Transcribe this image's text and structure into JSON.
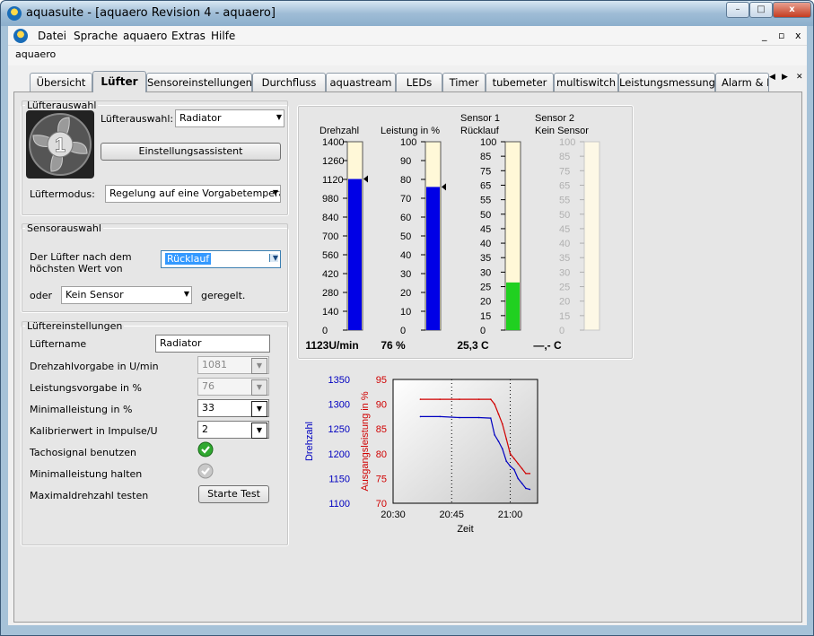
{
  "window": {
    "title": "aquasuite - [aquaero Revision 4 -  aquaero]",
    "buttons": {
      "min": "–",
      "max": "□",
      "close": "x"
    }
  },
  "menu": {
    "items": [
      "Datei",
      "Sprache",
      "aquaero",
      "Extras",
      "Hilfe"
    ],
    "mdi": [
      "_",
      "▫",
      "x"
    ]
  },
  "subtitle": "aquaero",
  "tabs": [
    "Übersicht",
    "Lüfter",
    "Sensoreinstellungen",
    "Durchfluss",
    "aquastream",
    "LEDs",
    "Timer",
    "tubemeter",
    "multiswitch",
    "Leistungsmessung",
    "Alarm & R"
  ],
  "active_tab": "Lüfter",
  "fan_select": {
    "legend": "Lüfterauswahl",
    "fan_number": "1",
    "label": "Lüfterauswahl:",
    "value": "Radiator",
    "assistant": "Einstellungsassistent",
    "mode_label": "Lüftermodus:",
    "mode_value": "Regelung auf eine Vorgabetemperatu"
  },
  "sensor_select": {
    "legend": "Sensorauswahl",
    "text1": "Der Lüfter nach dem",
    "text2": "höchsten Wert von",
    "sensor1": "Rücklauf",
    "or": "oder",
    "sensor2": "Kein Sensor",
    "suffix": "geregelt."
  },
  "fan_settings": {
    "legend": "Lüftereinstellungen",
    "name_label": "Lüftername",
    "name_value": "Radiator",
    "rpm_label": "Drehzahlvorgabe in U/min",
    "rpm_value": "1081",
    "power_label": "Leistungsvorgabe in %",
    "power_value": "76",
    "minpower_label": "Minimalleistung in %",
    "minpower_value": "33",
    "calib_label": "Kalibrierwert in Impulse/U",
    "calib_value": "2",
    "tacho_label": "Tachosignal benutzen",
    "tacho_checked": true,
    "hold_label": "Minimalleistung halten",
    "hold_checked": false,
    "test_label": "Maximaldrehzahl testen",
    "test_button": "Starte Test"
  },
  "gauges": [
    {
      "title": "Drehzahl",
      "title2": "",
      "ticks": [
        "1400",
        "1260",
        "1120",
        "980",
        "840",
        "700",
        "560",
        "420",
        "280",
        "140",
        "0"
      ],
      "max": 1400,
      "value": 1123,
      "marker": 1123,
      "color": "#0000e6",
      "readout": "1123U/min",
      "enabled": true
    },
    {
      "title": "Leistung in %",
      "title2": "",
      "ticks": [
        "100",
        "90",
        "80",
        "70",
        "60",
        "50",
        "40",
        "30",
        "20",
        "10",
        "0"
      ],
      "max": 100,
      "value": 76,
      "marker": 76,
      "color": "#0000e6",
      "readout": "76 %",
      "enabled": true
    },
    {
      "title": "Sensor 1",
      "title2": "Rücklauf",
      "ticks": [
        "100",
        "85",
        "75",
        "65",
        "55",
        "50",
        "45",
        "40",
        "35",
        "30",
        "25",
        "20",
        "15",
        "0"
      ],
      "max": 100,
      "value": 25.3,
      "color": "#20d020",
      "readout": "25,3 C",
      "enabled": true
    },
    {
      "title": "Sensor 2",
      "title2": "Kein Sensor",
      "ticks": [
        "100",
        "85",
        "75",
        "65",
        "55",
        "50",
        "45",
        "40",
        "35",
        "30",
        "25",
        "20",
        "15",
        "0"
      ],
      "max": 100,
      "value": 0,
      "color": "#20d020",
      "readout": "—,- C",
      "enabled": false
    }
  ],
  "chart_data": {
    "type": "line",
    "xlabel": "Zeit",
    "x_ticks": [
      "20:30",
      "20:45",
      "21:00"
    ],
    "xlim": [
      "20:30",
      "21:07"
    ],
    "y1": {
      "label": "Drehzahl",
      "ticks": [
        "1350",
        "1300",
        "1250",
        "1200",
        "1150",
        "1100"
      ],
      "ylim": [
        1100,
        1350
      ],
      "color": "#0000c0"
    },
    "y2": {
      "label": "Ausgangsleistung in %",
      "ticks": [
        "95",
        "90",
        "85",
        "80",
        "75",
        "70"
      ],
      "ylim": [
        70,
        95
      ],
      "color": "#d00000"
    },
    "series": [
      {
        "name": "Drehzahl",
        "axis": "y1",
        "color": "#0000c0",
        "x": [
          "20:37",
          "20:42",
          "20:47",
          "20:52",
          "20:55",
          "20:56",
          "20:57",
          "20:58",
          "20:59",
          "21:00",
          "21:01",
          "21:02",
          "21:03",
          "21:04",
          "21:05"
        ],
        "y": [
          1275,
          1275,
          1273,
          1273,
          1272,
          1238,
          1225,
          1210,
          1185,
          1175,
          1168,
          1150,
          1140,
          1130,
          1128
        ]
      },
      {
        "name": "Ausgangsleistung in %",
        "axis": "y2",
        "color": "#d00000",
        "x": [
          "20:37",
          "20:42",
          "20:47",
          "20:52",
          "20:55",
          "20:56",
          "20:57",
          "20:58",
          "20:59",
          "21:00",
          "21:01",
          "21:02",
          "21:03",
          "21:04",
          "21:05"
        ],
        "y": [
          91,
          91,
          91,
          91,
          91,
          90,
          88,
          86,
          83,
          80,
          79,
          78,
          77,
          76,
          76
        ]
      }
    ]
  }
}
